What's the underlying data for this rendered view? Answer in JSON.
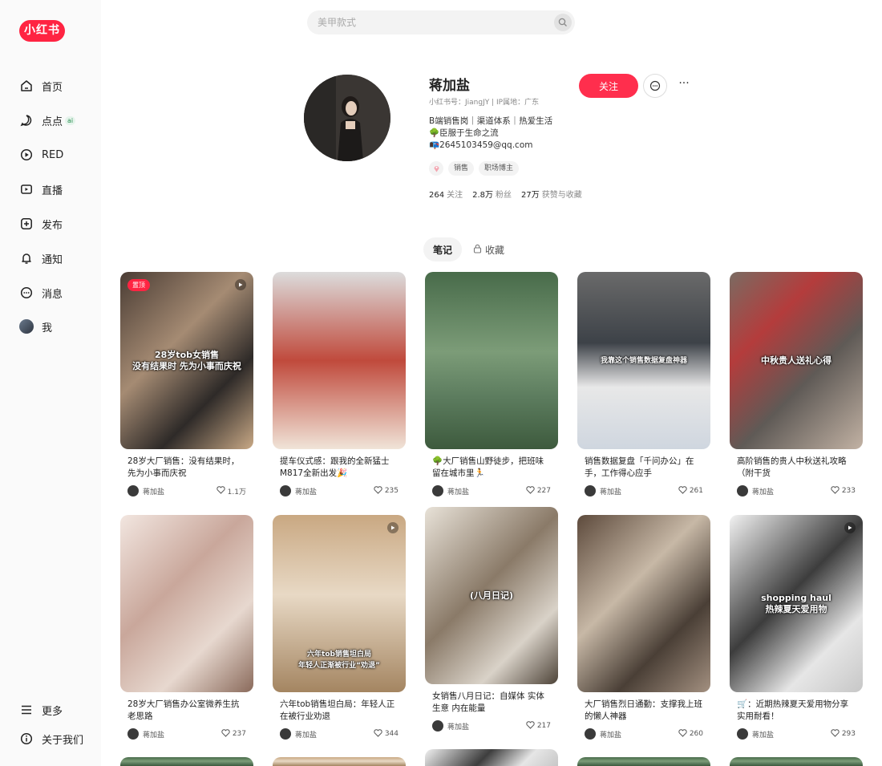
{
  "brand": {
    "logo_text": "小红书"
  },
  "sidebar": {
    "items": [
      {
        "key": "home",
        "label": "首页",
        "icon": "home-icon"
      },
      {
        "key": "diandian",
        "label": "点点",
        "icon": "chat-bubble-icon",
        "badge": "ai"
      },
      {
        "key": "red",
        "label": "RED",
        "icon": "play-circle-icon"
      },
      {
        "key": "live",
        "label": "直播",
        "icon": "live-icon"
      },
      {
        "key": "publish",
        "label": "发布",
        "icon": "plus-square-icon"
      },
      {
        "key": "notify",
        "label": "通知",
        "icon": "bell-icon"
      },
      {
        "key": "messages",
        "label": "消息",
        "icon": "message-icon"
      },
      {
        "key": "me",
        "label": "我",
        "icon": "avatar"
      }
    ],
    "bottom": [
      {
        "key": "more",
        "label": "更多",
        "icon": "menu-icon"
      },
      {
        "key": "about",
        "label": "关于我们",
        "icon": "info-icon"
      }
    ]
  },
  "search": {
    "placeholder": "美甲款式"
  },
  "profile": {
    "name": "蒋加盐",
    "meta": "小红书号：JiangJY | IP属地：广东",
    "bio": [
      "B端销售岗｜渠道体系｜热爱生活",
      "🌳臣服于生命之流",
      "📭2645103459@qq.com"
    ],
    "tags": [
      "销售",
      "职场博主"
    ],
    "stats": [
      {
        "num": "264",
        "label": "关注"
      },
      {
        "num": "2.8万",
        "label": "粉丝"
      },
      {
        "num": "27万",
        "label": "获赞与收藏"
      }
    ],
    "follow_label": "关注"
  },
  "tabs": {
    "notes": "笔记",
    "favorites": "收藏"
  },
  "accent": "#ff2442",
  "cards": [
    {
      "title": "28岁大厂销售：没有结果时，先为小事而庆祝",
      "author": "蒋加盐",
      "likes": "1.1万",
      "pinned": "置顶",
      "overlay": "28岁tob女销售\n没有结果时 先为小事而庆祝",
      "video": true
    },
    {
      "title": "提车仪式感：跟我的全新猛士M817全新出发🎉",
      "author": "蒋加盐",
      "likes": "235"
    },
    {
      "title": "🌳大厂销售山野徒步，把班味留在城市里🏃",
      "author": "蒋加盐",
      "likes": "227"
    },
    {
      "title": "销售数据复盘「千问办公」在手，工作得心应手",
      "author": "蒋加盐",
      "likes": "261",
      "overlay": "我靠这个销售数据复盘神器"
    },
    {
      "title": "高阶销售的贵人中秋送礼攻略（附干货",
      "author": "蒋加盐",
      "likes": "233",
      "overlay": "中秋贵人送礼心得"
    },
    {
      "title": "28岁大厂销售办公室微养生抗老思路",
      "author": "蒋加盐",
      "likes": "237"
    },
    {
      "title": "六年tob销售坦白局：年轻人正在被行业劝退",
      "author": "蒋加盐",
      "likes": "344",
      "overlay": "六年tob销售坦白局\n年轻人正渐被行业“劝退”",
      "video": true
    },
    {
      "title": "女销售八月日记：自媒体 实体生意 内在能量",
      "author": "蒋加盐",
      "likes": "217",
      "overlay": "(八月日记)"
    },
    {
      "title": "大厂销售烈日通勤：支撑我上班的懒人神器",
      "author": "蒋加盐",
      "likes": "260"
    },
    {
      "title": "🛒：近期热辣夏天爱用物分享 实用耐看！",
      "author": "蒋加盐",
      "likes": "293",
      "overlay": "shopping haul\n热辣夏天爱用物",
      "video": true
    }
  ]
}
